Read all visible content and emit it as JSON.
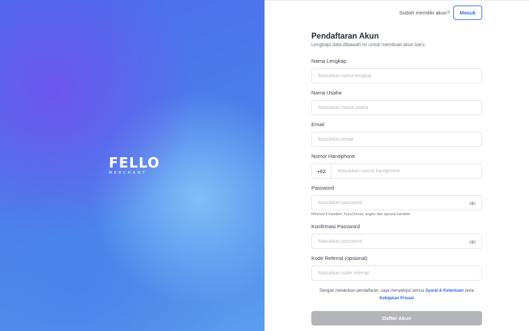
{
  "brand": {
    "logo_main": "FELLO",
    "logo_sub": "MERCHANT"
  },
  "header": {
    "prompt": "Sudah memiliki akun?",
    "login_label": "Masuk"
  },
  "form": {
    "title": "Pendaftaran Akun",
    "subtitle": "Lengkapi data dibawah ini untuk membuat akun baru",
    "full_name": {
      "label": "Nama Lengkap",
      "placeholder": "Masukkan nama lengkap"
    },
    "business_name": {
      "label": "Nama Usaha",
      "placeholder": "Masukkan nama usaha"
    },
    "email": {
      "label": "Email",
      "placeholder": "Masukkan email"
    },
    "phone": {
      "label": "Nomor Handphone",
      "prefix": "+62",
      "placeholder": "Masukkan nomor handphone"
    },
    "password": {
      "label": "Password",
      "placeholder": "Masukkan password",
      "hint": "Minimal 8 karakter, huruf besar, angka dan spesial karakter"
    },
    "confirm_password": {
      "label": "Konfirmasi Password",
      "placeholder": "Masukkan password"
    },
    "referral": {
      "label": "Kode Referral (opsional)",
      "placeholder": "Masukkan kode referral"
    },
    "terms": {
      "prefix": "Dengan melakukan pendaftaran, saya menyetujui semua ",
      "link_terms": "Syarat & Ketentuan",
      "middle": " serta",
      "link_privacy": "Kebijakan Privasi"
    },
    "submit_label": "Daftar Akun"
  },
  "colors": {
    "accent": "#3b6fe0",
    "submit_disabled": "#b3b5b9"
  }
}
